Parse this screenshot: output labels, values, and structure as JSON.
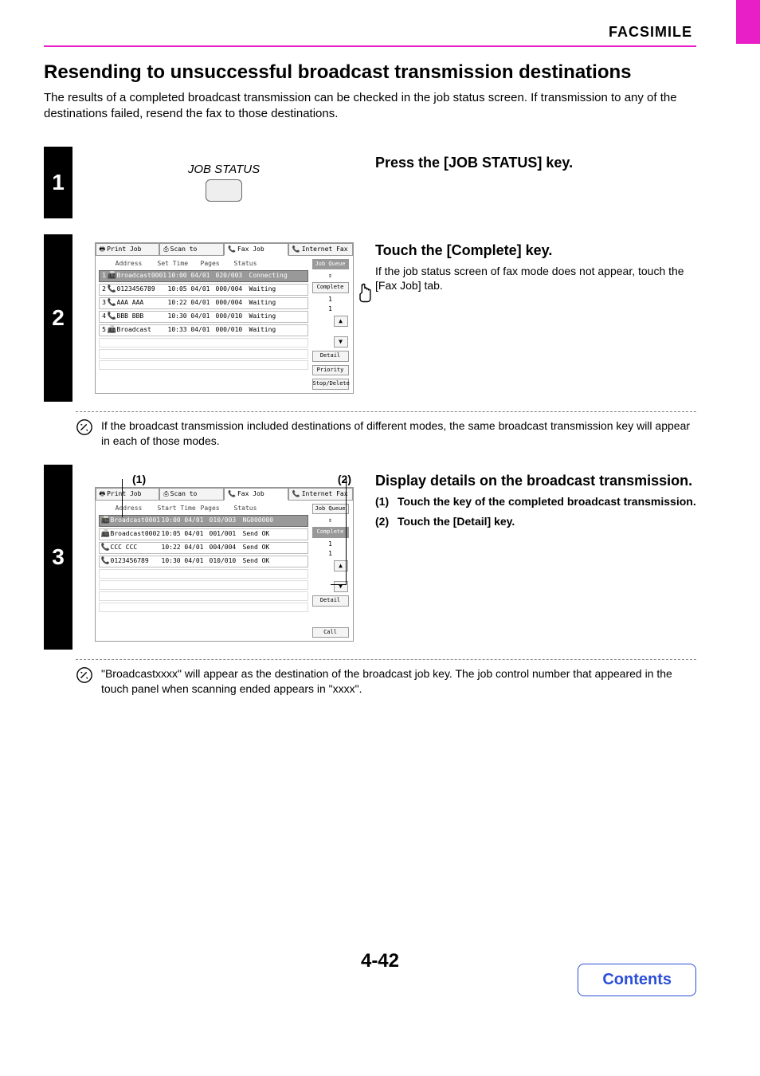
{
  "header": {
    "section_label": "FACSIMILE",
    "title": "Resending to unsuccessful broadcast transmission destinations",
    "intro": "The results of a completed broadcast transmission can be checked in the job status screen. If transmission to any of the destinations failed, resend the fax to those destinations."
  },
  "step1": {
    "num": "1",
    "key_label": "JOB STATUS",
    "heading": "Press the [JOB STATUS] key."
  },
  "step2": {
    "num": "2",
    "heading": "Touch the [Complete] key.",
    "body": "If the job status screen of fax mode does not appear, touch the [Fax Job] tab.",
    "note": "If the broadcast transmission included destinations of different modes, the same broadcast transmission key will appear in each of those modes.",
    "panel": {
      "tabs": [
        "Print Job",
        "Scan to",
        "Fax Job",
        "Internet Fax"
      ],
      "active_tab_index": 2,
      "columns": [
        "Address",
        "Set Time",
        "Pages",
        "Status"
      ],
      "rows": [
        {
          "n": "1",
          "addr": "Broadcast0001",
          "time": "10:00 04/01",
          "pages": "020/003",
          "status": "Connecting",
          "sel": true
        },
        {
          "n": "2",
          "addr": "0123456789",
          "time": "10:05 04/01",
          "pages": "000/004",
          "status": "Waiting"
        },
        {
          "n": "3",
          "addr": "AAA AAA",
          "time": "10:22 04/01",
          "pages": "000/004",
          "status": "Waiting"
        },
        {
          "n": "4",
          "addr": "BBB BBB",
          "time": "10:30 04/01",
          "pages": "000/010",
          "status": "Waiting"
        },
        {
          "n": "5",
          "addr": "Broadcast",
          "time": "10:33 04/01",
          "pages": "000/010",
          "status": "Waiting"
        }
      ],
      "page_ind_top": "1",
      "page_ind_bot": "1",
      "side_buttons": {
        "job_queue": "Job Queue",
        "complete": "Complete",
        "detail": "Detail",
        "priority": "Priority",
        "stop_delete": "Stop/Delete"
      }
    }
  },
  "step3": {
    "num": "3",
    "heading": "Display details on the broadcast transmission.",
    "callout1": "(1)",
    "callout2": "(2)",
    "li1_num": "(1)",
    "li1_text": "Touch the key of the completed broadcast transmission.",
    "li2_num": "(2)",
    "li2_text": "Touch the [Detail] key.",
    "note": "\"Broadcastxxxx\" will appear as the destination of the broadcast job key. The job control number that appeared in the touch panel when scanning ended appears in \"xxxx\".",
    "panel": {
      "tabs": [
        "Print Job",
        "Scan to",
        "Fax Job",
        "Internet Fax"
      ],
      "active_tab_index": 2,
      "columns": [
        "Address",
        "Start Time",
        "Pages",
        "Status"
      ],
      "rows": [
        {
          "addr": "Broadcast0001",
          "time": "10:00 04/01",
          "pages": "010/003",
          "status": "NG000000",
          "sel": true
        },
        {
          "addr": "Broadcast0002",
          "time": "10:05 04/01",
          "pages": "001/001",
          "status": "Send OK"
        },
        {
          "addr": "CCC CCC",
          "time": "10:22 04/01",
          "pages": "004/004",
          "status": "Send OK"
        },
        {
          "addr": "0123456789",
          "time": "10:30 04/01",
          "pages": "010/010",
          "status": "Send OK"
        }
      ],
      "page_ind_top": "1",
      "page_ind_bot": "1",
      "side_buttons": {
        "job_queue": "Job Queue",
        "complete": "Complete",
        "detail": "Detail",
        "call": "Call"
      }
    }
  },
  "page_number": "4-42",
  "contents_button": "Contents"
}
